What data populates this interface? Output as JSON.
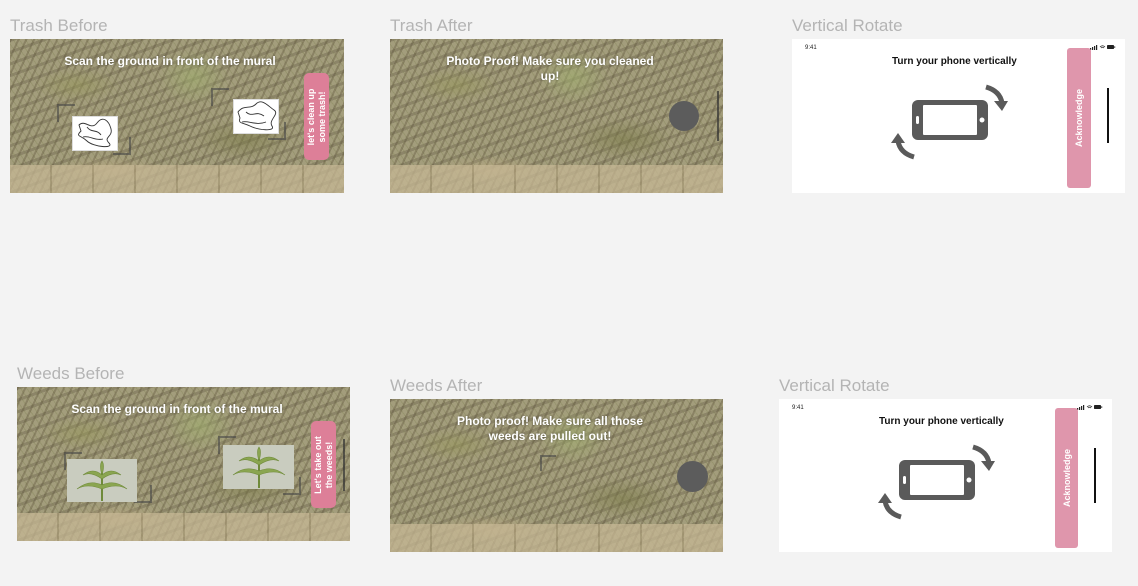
{
  "frames": {
    "trash_before": {
      "label": "Trash Before",
      "instruction": "Scan the ground in front of the mural",
      "button_label_line1": "let's clean up",
      "button_label_line2": "some trash!"
    },
    "trash_after": {
      "label": "Trash After",
      "instruction_line1": "Photo Proof! Make sure you cleaned",
      "instruction_line2": "up!"
    },
    "vertical_rotate_1": {
      "label": "Vertical Rotate",
      "time": "9:41",
      "title": "Turn your phone vertically",
      "button_label": "Acknowledge"
    },
    "weeds_before": {
      "label": "Weeds Before",
      "instruction": "Scan the ground in front of the mural",
      "button_label_line1": "Let's take out",
      "button_label_line2": "the weeds!"
    },
    "weeds_after": {
      "label": "Weeds After",
      "instruction_line1": "Photo proof! Make sure all those",
      "instruction_line2": "weeds are pulled out!"
    },
    "vertical_rotate_2": {
      "label": "Vertical Rotate",
      "time": "9:41",
      "title": "Turn your phone vertically",
      "button_label": "Acknowledge"
    }
  },
  "icons": {
    "marker": "trash-marker-icon",
    "plant": "weed-plant-icon",
    "rotate": "rotate-phone-icon",
    "status": "status-bar-icons"
  },
  "colors": {
    "accent_pink": "#dd7f98",
    "ack_pink": "#df96ac",
    "shutter": "#5c5c5c",
    "canvas": "#f3f3f3"
  }
}
